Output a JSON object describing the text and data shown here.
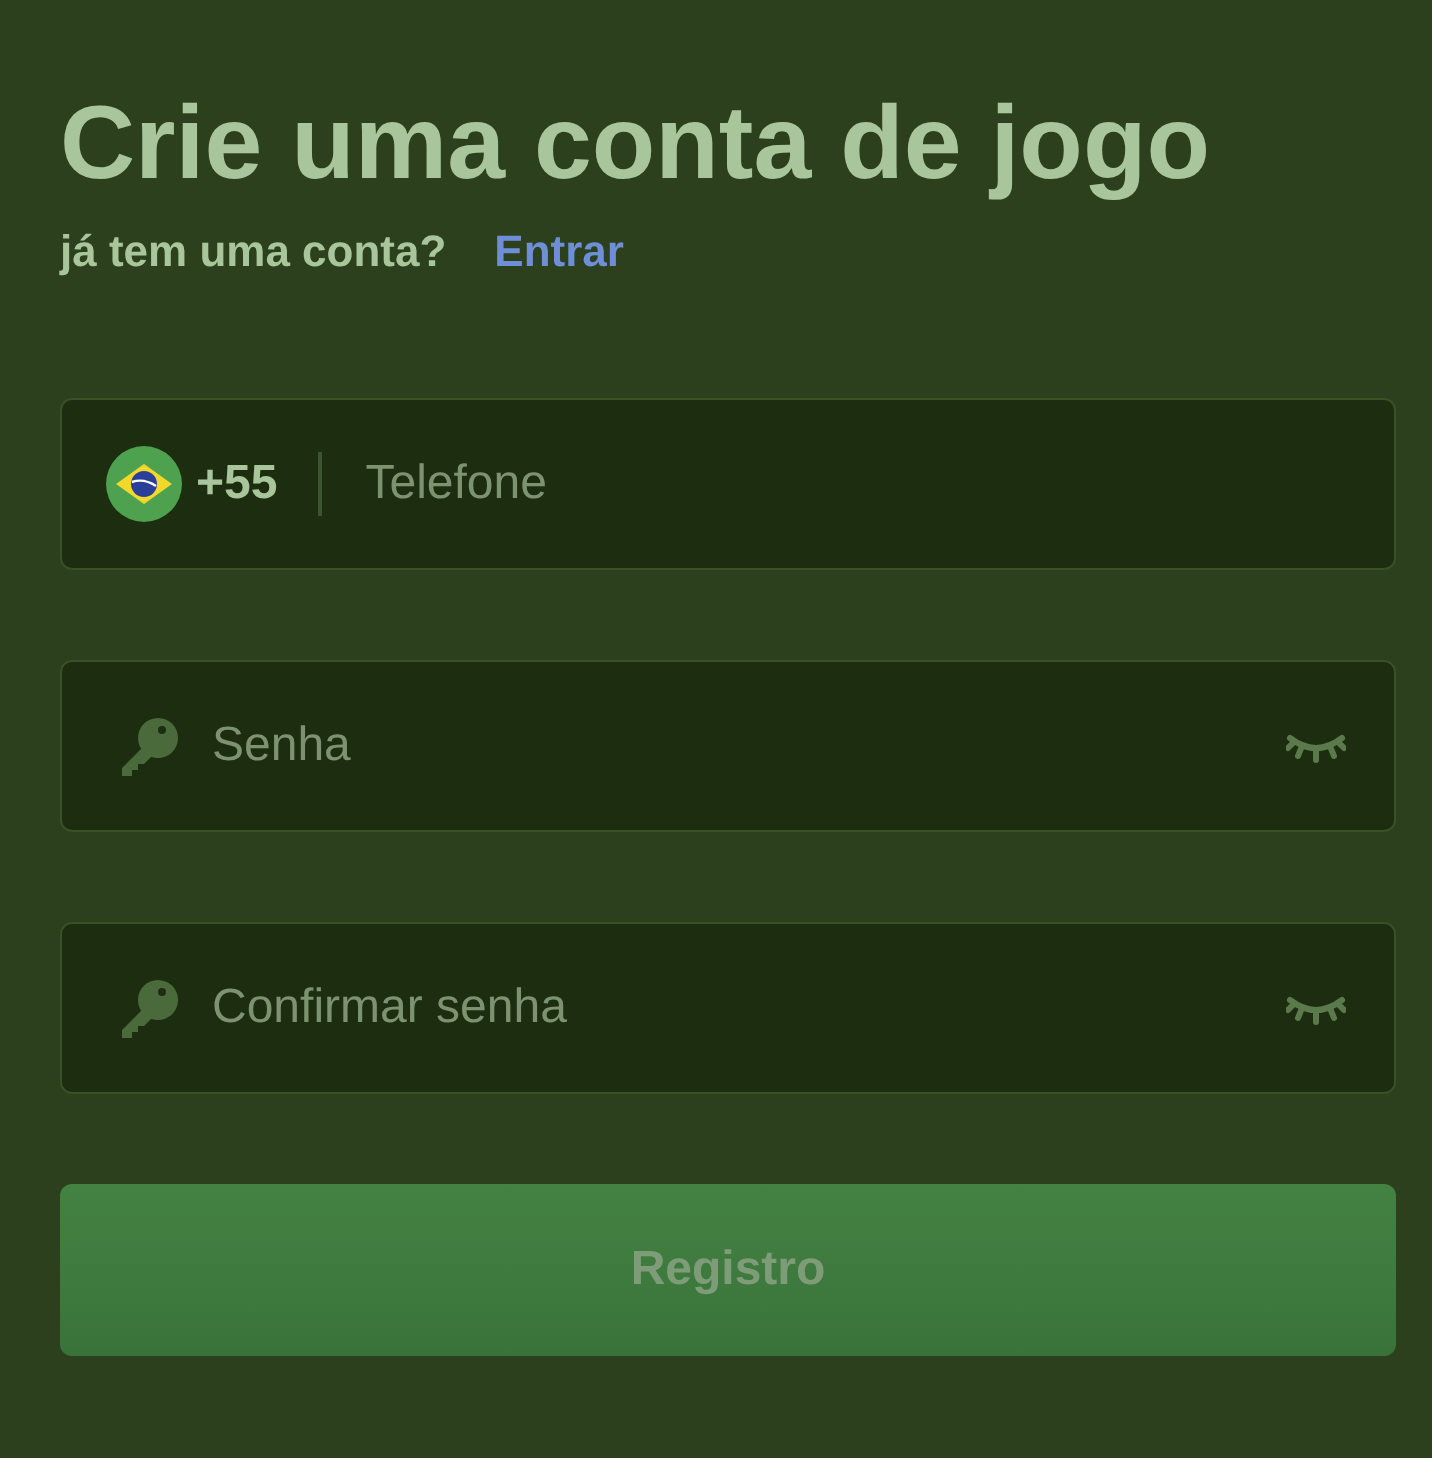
{
  "title": "Crie uma conta de jogo",
  "subtitle": {
    "text": "já tem uma conta?",
    "link": "Entrar"
  },
  "phone": {
    "code": "+55",
    "placeholder": "Telefone"
  },
  "fields": [
    {
      "kind": "password",
      "placeholder": "Senha"
    },
    {
      "kind": "password",
      "placeholder": "Confirmar senha"
    }
  ],
  "submit": {
    "label": "Registro",
    "disabled": true
  }
}
